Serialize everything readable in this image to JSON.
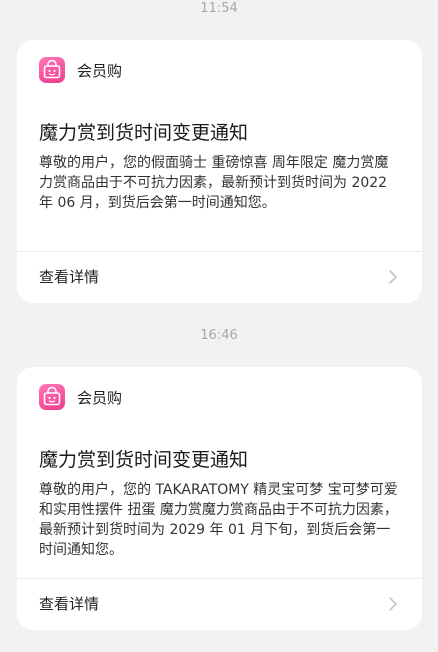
{
  "notifications": [
    {
      "timestamp": "11:54",
      "app_name": "会员购",
      "title": "魔力赏到货时间变更通知",
      "body": "尊敬的用户，您的假面骑士 重磅惊喜 周年限定 魔力赏魔力赏商品由于不可抗力因素，最新预计到货时间为 2022 年 06 月，到货后会第一时间通知您。",
      "action_label": "查看详情"
    },
    {
      "timestamp": "16:46",
      "app_name": "会员购",
      "title": "魔力赏到货时间变更通知",
      "body": "尊敬的用户，您的 TAKARATOMY 精灵宝可梦 宝可梦可爱和实用性摆件 扭蛋 魔力赏魔力赏商品由于不可抗力因素，最新预计到货时间为 2029 年 01 月下旬，到货后会第一时间通知您。",
      "action_label": "查看详情"
    }
  ],
  "icons": {
    "app_icon": "shopping-bag-icon",
    "chevron": "chevron-right-icon"
  },
  "colors": {
    "background": "#f2f2f2",
    "card": "#ffffff",
    "app_icon_pink": "#f03b8d",
    "timestamp_gray": "#a8a8a8"
  }
}
